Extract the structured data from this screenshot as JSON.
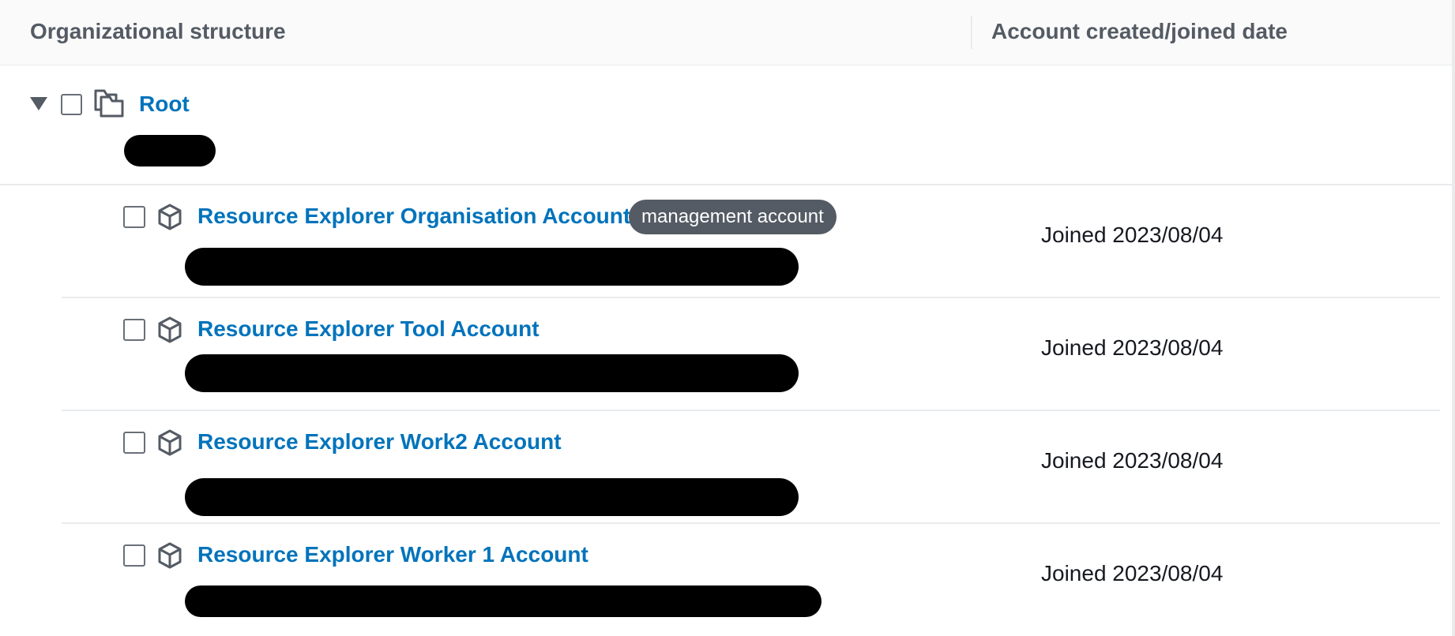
{
  "header": {
    "col_structure": "Organizational structure",
    "col_date": "Account created/joined date"
  },
  "root": {
    "name": "Root",
    "expanded": true
  },
  "accounts": [
    {
      "name": "Resource Explorer Organisation Account",
      "badge": "management account",
      "date": "Joined 2023/08/04"
    },
    {
      "name": "Resource Explorer Tool Account",
      "date": "Joined 2023/08/04"
    },
    {
      "name": "Resource Explorer Work2 Account",
      "date": "Joined 2023/08/04"
    },
    {
      "name": "Resource Explorer Worker 1 Account",
      "date": "Joined 2023/08/04"
    }
  ],
  "icons": {
    "expand": "caret-down-icon",
    "root": "organizational-unit-icon",
    "account": "account-cube-icon"
  },
  "colors": {
    "link": "#0073bb",
    "header_text": "#545b64",
    "badge_bg": "#545b64",
    "border": "#e9ebed",
    "redaction": "#000000"
  }
}
